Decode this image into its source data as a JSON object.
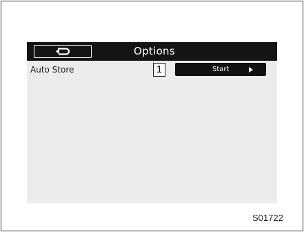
{
  "header": {
    "title": "Options",
    "back_icon": "back-return-icon"
  },
  "options": {
    "rows": [
      {
        "label": "Auto Store",
        "callout": "1",
        "button_label": "Start",
        "button_icon": "play-arrow-icon"
      }
    ]
  },
  "figure_code": "S01722",
  "colors": {
    "header_bg": "#141414",
    "screen_bg": "#ececec",
    "button_bg": "#111111",
    "text_light": "#ffffff"
  }
}
